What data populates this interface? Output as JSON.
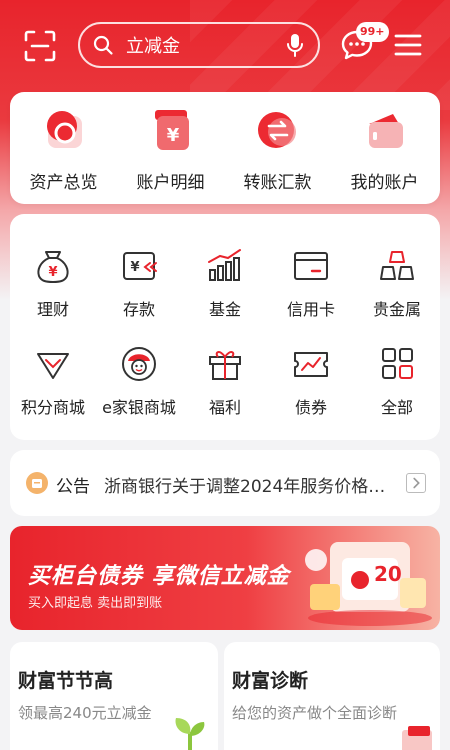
{
  "colors": {
    "brand_red": "#e8242c",
    "bg": "#f3f3f5"
  },
  "topbar": {
    "search_text": "立减金",
    "message_badge": "99+",
    "icons": [
      "scan-icon",
      "search-icon",
      "mic-icon",
      "message-icon",
      "menu-icon"
    ]
  },
  "quick_actions": [
    {
      "label": "资产总览",
      "icon": "asset-overview-icon"
    },
    {
      "label": "账户明细",
      "icon": "account-detail-icon"
    },
    {
      "label": "转账汇款",
      "icon": "transfer-icon"
    },
    {
      "label": "我的账户",
      "icon": "my-account-icon"
    }
  ],
  "services": [
    {
      "label": "理财",
      "icon": "money-bag-icon"
    },
    {
      "label": "存款",
      "icon": "deposit-icon"
    },
    {
      "label": "基金",
      "icon": "fund-chart-icon"
    },
    {
      "label": "信用卡",
      "icon": "credit-card-icon"
    },
    {
      "label": "贵金属",
      "icon": "gold-bars-icon"
    },
    {
      "label": "积分商城",
      "icon": "points-mall-icon"
    },
    {
      "label": "e家银商城",
      "icon": "e-mall-icon"
    },
    {
      "label": "福利",
      "icon": "gift-icon"
    },
    {
      "label": "债券",
      "icon": "bond-icon"
    },
    {
      "label": "全部",
      "icon": "all-grid-icon"
    }
  ],
  "notice": {
    "title": "公告",
    "text": "浙商银行关于调整2024年服务价格…"
  },
  "banner": {
    "title": "买柜台债券 享微信立减金",
    "subtitle": "买入即起息  卖出即到账",
    "amount": "20"
  },
  "wealth_left": {
    "title": "财富节节高",
    "desc": "领最高240元立减金"
  },
  "wealth_right": {
    "title": "财富诊断",
    "desc": "给您的资产做个全面诊断"
  }
}
